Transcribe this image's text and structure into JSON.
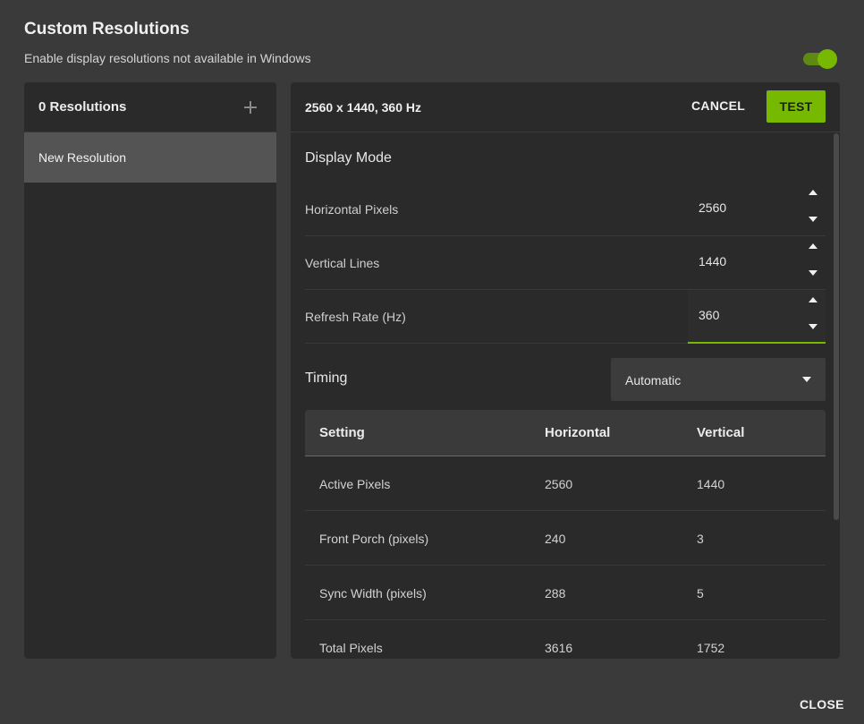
{
  "dialog": {
    "title": "Custom Resolutions",
    "subtitle": "Enable display resolutions not available in Windows",
    "toggle_on": true,
    "close_label": "CLOSE"
  },
  "left_panel": {
    "count_label": "0 Resolutions",
    "add_icon": "plus-icon",
    "items": [
      {
        "label": "New Resolution",
        "selected": true
      }
    ]
  },
  "right_panel": {
    "header_title": "2560 x 1440, 360 Hz",
    "cancel_label": "CANCEL",
    "test_label": "TEST",
    "display_mode": {
      "title": "Display Mode",
      "fields": [
        {
          "label": "Horizontal Pixels",
          "value": "2560"
        },
        {
          "label": "Vertical Lines",
          "value": "1440"
        },
        {
          "label": "Refresh Rate (Hz)",
          "value": "360"
        }
      ]
    },
    "timing": {
      "label": "Timing",
      "selected": "Automatic"
    },
    "table": {
      "headers": [
        "Setting",
        "Horizontal",
        "Vertical"
      ],
      "rows": [
        [
          "Active Pixels",
          "2560",
          "1440"
        ],
        [
          "Front Porch (pixels)",
          "240",
          "3"
        ],
        [
          "Sync Width (pixels)",
          "288",
          "5"
        ],
        [
          "Total Pixels",
          "3616",
          "1752"
        ]
      ]
    }
  },
  "colors": {
    "accent": "#76b900",
    "panel": "#2a2a2a",
    "background": "#3a3a3a"
  }
}
